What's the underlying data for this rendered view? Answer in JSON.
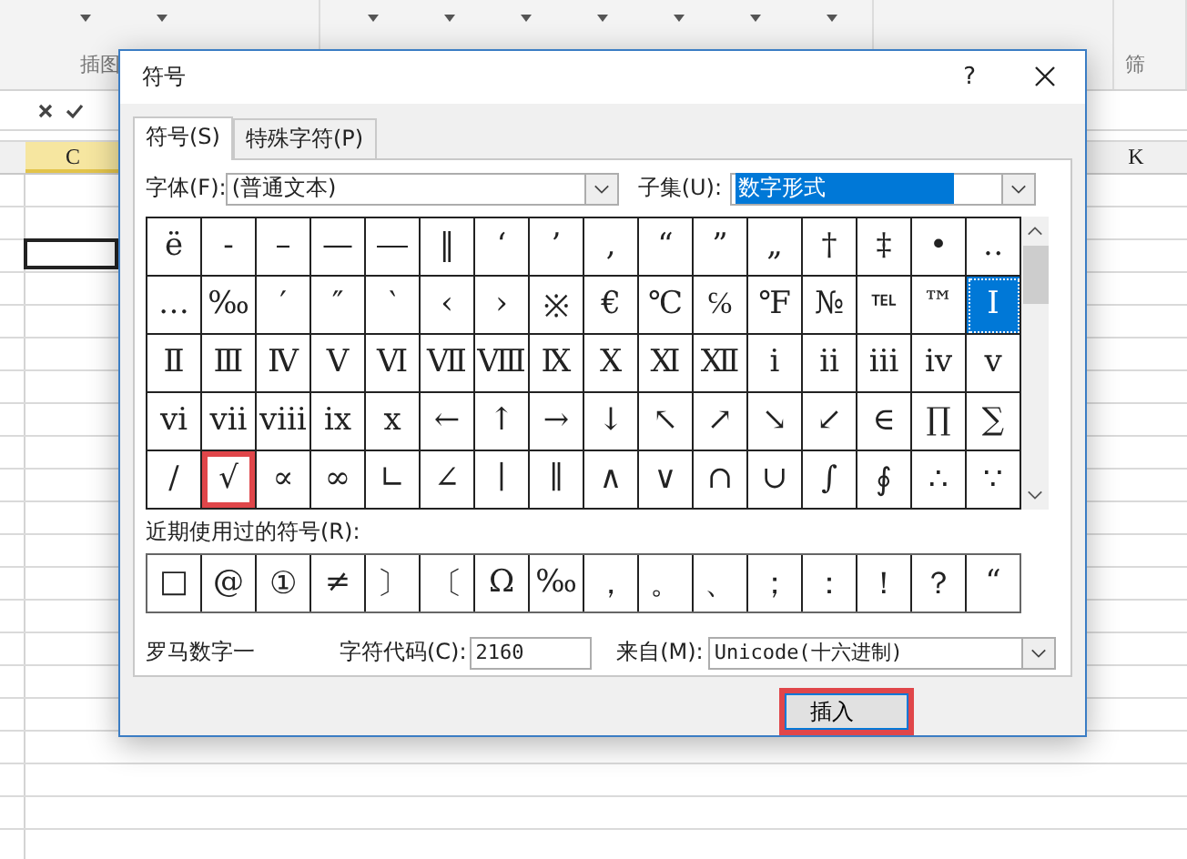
{
  "ribbon": {
    "group_labels": [
      "插图",
      "筛"
    ]
  },
  "columns": [
    {
      "label": "C",
      "selected": true
    },
    {
      "label": "K",
      "selected": false
    }
  ],
  "dialog": {
    "title": "符号",
    "help": "?",
    "tabs": [
      {
        "label": "符号(S)",
        "selected": true
      },
      {
        "label": "特殊字符(P)",
        "selected": false
      }
    ],
    "font": {
      "label": "字体(F):",
      "value": "(普通文本)"
    },
    "subset": {
      "label": "子集(U):",
      "value": "数字形式"
    },
    "symbols": [
      [
        {
          "char": "ë",
          "selected": false,
          "highlighted": false
        },
        {
          "char": "-",
          "selected": false,
          "highlighted": false
        },
        {
          "char": "–",
          "selected": false,
          "highlighted": false
        },
        {
          "char": "—",
          "selected": false,
          "highlighted": false
        },
        {
          "char": "―",
          "selected": false,
          "highlighted": false
        },
        {
          "char": "‖",
          "selected": false,
          "highlighted": false
        },
        {
          "char": "‘",
          "selected": false,
          "highlighted": false
        },
        {
          "char": "’",
          "selected": false,
          "highlighted": false
        },
        {
          "char": "‚",
          "selected": false,
          "highlighted": false
        },
        {
          "char": "“",
          "selected": false,
          "highlighted": false
        },
        {
          "char": "”",
          "selected": false,
          "highlighted": false
        },
        {
          "char": "„",
          "selected": false,
          "highlighted": false
        },
        {
          "char": "†",
          "selected": false,
          "highlighted": false
        },
        {
          "char": "‡",
          "selected": false,
          "highlighted": false
        },
        {
          "char": "•",
          "selected": false,
          "highlighted": false
        },
        {
          "char": "‥",
          "selected": false,
          "highlighted": false
        }
      ],
      [
        {
          "char": "…",
          "selected": false,
          "highlighted": false
        },
        {
          "char": "‰",
          "selected": false,
          "highlighted": false
        },
        {
          "char": "′",
          "selected": false,
          "highlighted": false
        },
        {
          "char": "″",
          "selected": false,
          "highlighted": false
        },
        {
          "char": "‵",
          "selected": false,
          "highlighted": false
        },
        {
          "char": "‹",
          "selected": false,
          "highlighted": false
        },
        {
          "char": "›",
          "selected": false,
          "highlighted": false
        },
        {
          "char": "※",
          "selected": false,
          "highlighted": false
        },
        {
          "char": "€",
          "selected": false,
          "highlighted": false
        },
        {
          "char": "℃",
          "selected": false,
          "highlighted": false
        },
        {
          "char": "℅",
          "selected": false,
          "highlighted": false
        },
        {
          "char": "℉",
          "selected": false,
          "highlighted": false
        },
        {
          "char": "№",
          "selected": false,
          "highlighted": false
        },
        {
          "char": "℡",
          "selected": false,
          "highlighted": false
        },
        {
          "char": "™",
          "selected": false,
          "highlighted": false
        },
        {
          "char": "Ⅰ",
          "selected": true,
          "highlighted": false
        }
      ],
      [
        {
          "char": "Ⅱ",
          "selected": false,
          "highlighted": false
        },
        {
          "char": "Ⅲ",
          "selected": false,
          "highlighted": false
        },
        {
          "char": "Ⅳ",
          "selected": false,
          "highlighted": false
        },
        {
          "char": "Ⅴ",
          "selected": false,
          "highlighted": false
        },
        {
          "char": "Ⅵ",
          "selected": false,
          "highlighted": false
        },
        {
          "char": "Ⅶ",
          "selected": false,
          "highlighted": false
        },
        {
          "char": "Ⅷ",
          "selected": false,
          "highlighted": false
        },
        {
          "char": "Ⅸ",
          "selected": false,
          "highlighted": false
        },
        {
          "char": "Ⅹ",
          "selected": false,
          "highlighted": false
        },
        {
          "char": "Ⅺ",
          "selected": false,
          "highlighted": false
        },
        {
          "char": "Ⅻ",
          "selected": false,
          "highlighted": false
        },
        {
          "char": "ⅰ",
          "selected": false,
          "highlighted": false
        },
        {
          "char": "ⅱ",
          "selected": false,
          "highlighted": false
        },
        {
          "char": "ⅲ",
          "selected": false,
          "highlighted": false
        },
        {
          "char": "ⅳ",
          "selected": false,
          "highlighted": false
        },
        {
          "char": "ⅴ",
          "selected": false,
          "highlighted": false
        }
      ],
      [
        {
          "char": "ⅵ",
          "selected": false,
          "highlighted": false
        },
        {
          "char": "ⅶ",
          "selected": false,
          "highlighted": false
        },
        {
          "char": "ⅷ",
          "selected": false,
          "highlighted": false
        },
        {
          "char": "ⅸ",
          "selected": false,
          "highlighted": false
        },
        {
          "char": "ⅹ",
          "selected": false,
          "highlighted": false
        },
        {
          "char": "←",
          "selected": false,
          "highlighted": false
        },
        {
          "char": "↑",
          "selected": false,
          "highlighted": false
        },
        {
          "char": "→",
          "selected": false,
          "highlighted": false
        },
        {
          "char": "↓",
          "selected": false,
          "highlighted": false
        },
        {
          "char": "↖",
          "selected": false,
          "highlighted": false
        },
        {
          "char": "↗",
          "selected": false,
          "highlighted": false
        },
        {
          "char": "↘",
          "selected": false,
          "highlighted": false
        },
        {
          "char": "↙",
          "selected": false,
          "highlighted": false
        },
        {
          "char": "∈",
          "selected": false,
          "highlighted": false
        },
        {
          "char": "∏",
          "selected": false,
          "highlighted": false
        },
        {
          "char": "∑",
          "selected": false,
          "highlighted": false
        }
      ],
      [
        {
          "char": "∕",
          "selected": false,
          "highlighted": false
        },
        {
          "char": "√",
          "selected": false,
          "highlighted": true
        },
        {
          "char": "∝",
          "selected": false,
          "highlighted": false
        },
        {
          "char": "∞",
          "selected": false,
          "highlighted": false
        },
        {
          "char": "∟",
          "selected": false,
          "highlighted": false
        },
        {
          "char": "∠",
          "selected": false,
          "highlighted": false
        },
        {
          "char": "∣",
          "selected": false,
          "highlighted": false
        },
        {
          "char": "∥",
          "selected": false,
          "highlighted": false
        },
        {
          "char": "∧",
          "selected": false,
          "highlighted": false
        },
        {
          "char": "∨",
          "selected": false,
          "highlighted": false
        },
        {
          "char": "∩",
          "selected": false,
          "highlighted": false
        },
        {
          "char": "∪",
          "selected": false,
          "highlighted": false
        },
        {
          "char": "∫",
          "selected": false,
          "highlighted": false
        },
        {
          "char": "∮",
          "selected": false,
          "highlighted": false
        },
        {
          "char": "∴",
          "selected": false,
          "highlighted": false
        },
        {
          "char": "∵",
          "selected": false,
          "highlighted": false
        }
      ]
    ],
    "recent_label": "近期使用过的符号(R):",
    "recent": [
      "□",
      "@",
      "①",
      "≠",
      "〕",
      "〔",
      "Ω",
      "‰",
      "，",
      "。",
      "、",
      "；",
      "：",
      "！",
      "？",
      "“"
    ],
    "description": "罗马数字一",
    "char_code": {
      "label": "字符代码(C):",
      "value": "2160"
    },
    "from": {
      "label": "来自(M):",
      "value": "Unicode(十六进制)"
    },
    "insert_button": {
      "label": "插入",
      "highlighted": true
    }
  }
}
